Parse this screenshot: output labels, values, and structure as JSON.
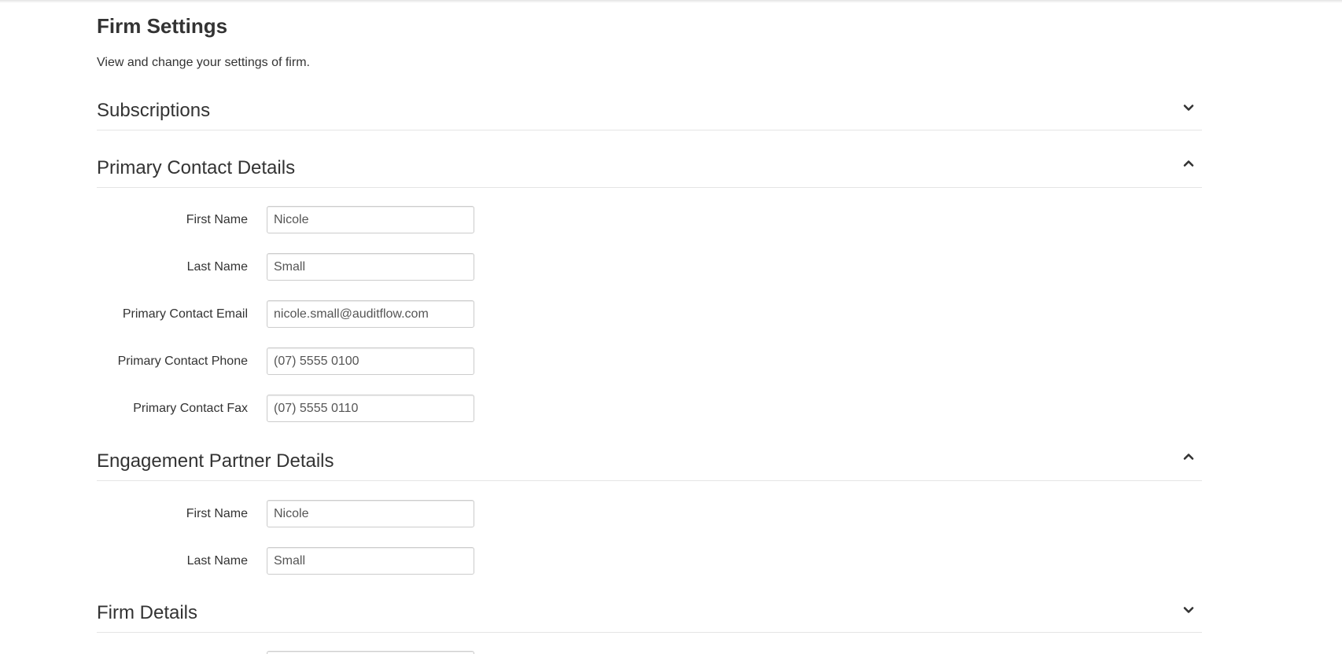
{
  "page": {
    "title": "Firm Settings",
    "subtitle": "View and change your settings of firm."
  },
  "sections": {
    "subscriptions": {
      "title": "Subscriptions",
      "expanded": false
    },
    "primary_contact": {
      "title": "Primary Contact Details",
      "expanded": true,
      "fields": {
        "first_name": {
          "label": "First Name",
          "value": "Nicole"
        },
        "last_name": {
          "label": "Last Name",
          "value": "Small"
        },
        "email": {
          "label": "Primary Contact Email",
          "value": "nicole.small@auditflow.com"
        },
        "phone": {
          "label": "Primary Contact Phone",
          "value": "(07) 5555 0100"
        },
        "fax": {
          "label": "Primary Contact Fax",
          "value": "(07) 5555 0110"
        }
      }
    },
    "engagement_partner": {
      "title": "Engagement Partner Details",
      "expanded": true,
      "fields": {
        "first_name": {
          "label": "First Name",
          "value": "Nicole"
        },
        "last_name": {
          "label": "Last Name",
          "value": "Small"
        }
      }
    },
    "firm_details": {
      "title": "Firm Details",
      "expanded": false
    }
  },
  "icons": {
    "expand": "chevron-down-icon",
    "collapse": "chevron-up-icon"
  }
}
